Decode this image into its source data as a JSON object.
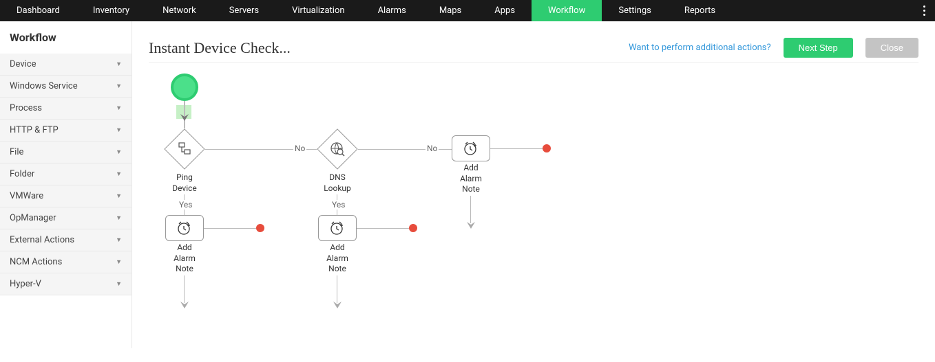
{
  "nav": {
    "items": [
      {
        "label": "Dashboard",
        "active": false
      },
      {
        "label": "Inventory",
        "active": false
      },
      {
        "label": "Network",
        "active": false
      },
      {
        "label": "Servers",
        "active": false
      },
      {
        "label": "Virtualization",
        "active": false
      },
      {
        "label": "Alarms",
        "active": false
      },
      {
        "label": "Maps",
        "active": false
      },
      {
        "label": "Apps",
        "active": false
      },
      {
        "label": "Workflow",
        "active": true
      },
      {
        "label": "Settings",
        "active": false
      },
      {
        "label": "Reports",
        "active": false
      }
    ]
  },
  "sidebar": {
    "title": "Workflow",
    "items": [
      {
        "label": "Device"
      },
      {
        "label": "Windows Service"
      },
      {
        "label": "Process"
      },
      {
        "label": "HTTP & FTP"
      },
      {
        "label": "File"
      },
      {
        "label": "Folder"
      },
      {
        "label": "VMWare"
      },
      {
        "label": "OpManager"
      },
      {
        "label": "External Actions"
      },
      {
        "label": "NCM Actions"
      },
      {
        "label": "Hyper-V"
      }
    ]
  },
  "header": {
    "title": "Instant Device Check...",
    "link": "Want to perform additional actions?",
    "next_btn": "Next Step",
    "close_btn": "Close"
  },
  "workflow": {
    "nodes": {
      "ping": {
        "label": "Ping\nDevice"
      },
      "dns": {
        "label": "DNS\nLookup"
      },
      "alarm1": {
        "label": "Add\nAlarm\nNote"
      },
      "alarm2": {
        "label": "Add\nAlarm\nNote"
      },
      "alarm3": {
        "label": "Add\nAlarm\nNote"
      }
    },
    "edges": {
      "yes": "Yes",
      "no": "No"
    }
  }
}
